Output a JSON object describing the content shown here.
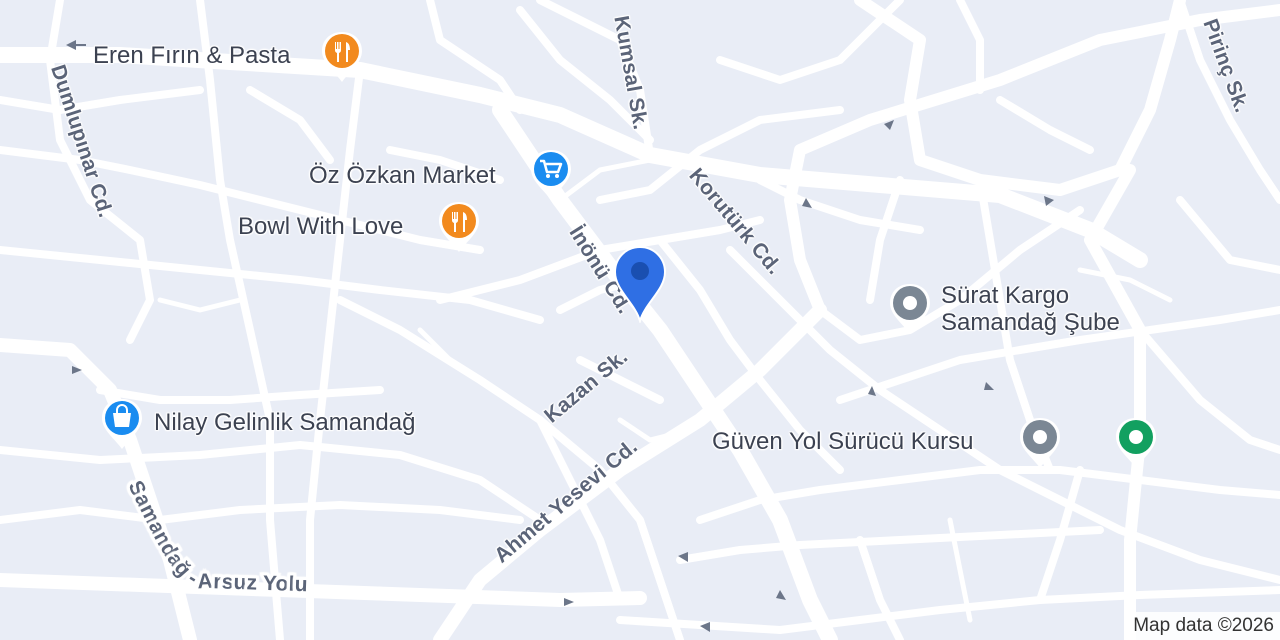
{
  "streets": {
    "kumsal": "Kumsal Sk.",
    "dumlupinar": "Dumlupınar Cd.",
    "korutürk": "Korutürk Cd.",
    "inonu": "İnönü Cd.",
    "kazan": "Kazan Sk.",
    "ahmet_yesevi": "Ahmet Yesevi Cd.",
    "samandag_arsuz": "Samandağ - Arsuz Yolu",
    "pirinc": "Pirinç Sk."
  },
  "pois": {
    "eren": {
      "label": "Eren Fırın & Pasta",
      "icon": "restaurant-icon",
      "color": "#f28a1e"
    },
    "ozkan": {
      "label": "Öz Özkan Market",
      "icon": "shopping-cart-icon",
      "color": "#1a8cf0"
    },
    "bowl": {
      "label": "Bowl With Love",
      "icon": "restaurant-icon",
      "color": "#f28a1e"
    },
    "surat": {
      "label_line1": "Sürat Kargo",
      "label_line2": "Samandağ Şube",
      "icon": "generic-place-icon",
      "color": "#7b8794"
    },
    "nilay": {
      "label": "Nilay Gelinlik Samandağ",
      "icon": "shopping-bag-icon",
      "color": "#1a8cf0"
    },
    "guven": {
      "label": "Güven Yol Sürücü Kursu",
      "icon": "generic-place-icon",
      "color": "#7b8794"
    },
    "green": {
      "icon": "place-icon",
      "color": "#12a060"
    }
  },
  "pin": {
    "icon": "location-pin-icon",
    "color": "#2f6fe4"
  },
  "attribution": "Map data ©2026",
  "colors": {
    "background": "#e9edf6",
    "road": "#ffffff"
  }
}
